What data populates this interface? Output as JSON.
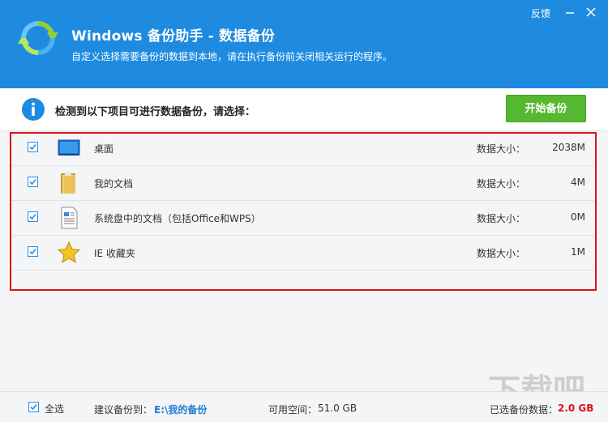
{
  "window": {
    "title": "Windows 备份助手 - 数据备份",
    "subtitle": "自定义选择需要备份的数据到本地，请在执行备份前关闭相关运行的程序。",
    "feedback_label": "反馈"
  },
  "info": {
    "message": "检测到以下项目可进行数据备份，请选择：",
    "start_button": "开始备份"
  },
  "items": [
    {
      "label": "桌面",
      "size_label": "数据大小：",
      "size": "2038M",
      "checked": true,
      "icon": "desktop-icon"
    },
    {
      "label": "我的文档",
      "size_label": "数据大小：",
      "size": "4M",
      "checked": true,
      "icon": "folder-icon"
    },
    {
      "label": "系统盘中的文档（包括Office和WPS）",
      "size_label": "数据大小：",
      "size": "0M",
      "checked": true,
      "icon": "document-icon"
    },
    {
      "label": "IE 收藏夹",
      "size_label": "数据大小：",
      "size": "1M",
      "checked": true,
      "icon": "star-icon"
    }
  ],
  "footer": {
    "select_all": "全选",
    "suggest_label": "建议备份到：",
    "path": "E:\\我的备份",
    "space_label": "可用空间：",
    "space_value": "51.0 GB",
    "selected_label": "已选备份数据：",
    "selected_value": "2.0 GB"
  },
  "colors": {
    "header": "#1e8be0",
    "start_button": "#56b830",
    "highlight_frame": "#d9111b",
    "path_link": "#1e7ed6"
  }
}
